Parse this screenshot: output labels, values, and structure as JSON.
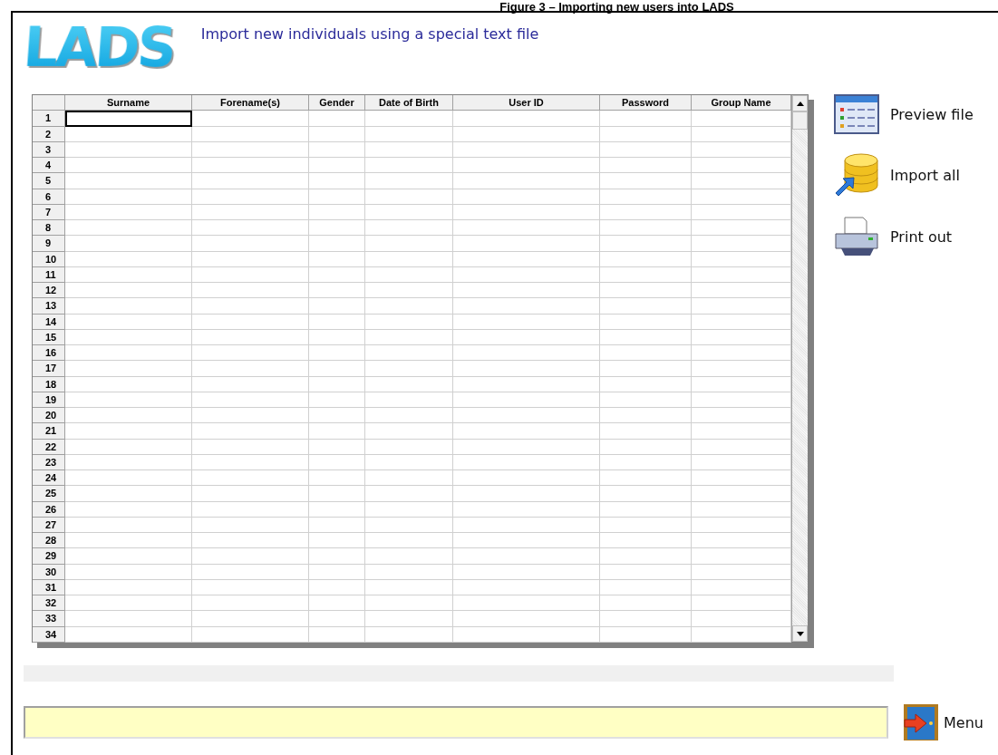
{
  "caption": "Figure 3 – Importing new users into LADS",
  "logo": "LADS",
  "heading": "Import new individuals using a special text file",
  "table": {
    "columns": [
      "Surname",
      "Forename(s)",
      "Gender",
      "Date of Birth",
      "User ID",
      "Password",
      "Group Name"
    ],
    "rows": [
      {
        "label": "1",
        "selected": true
      },
      {
        "label": "2",
        "selected": false
      },
      {
        "label": "3",
        "selected": false
      },
      {
        "label": "4",
        "selected": false
      },
      {
        "label": "5",
        "selected": false
      },
      {
        "label": "6",
        "selected": false
      },
      {
        "label": "7",
        "selected": false
      },
      {
        "label": "8",
        "selected": false
      },
      {
        "label": "9",
        "selected": false
      },
      {
        "label": "10",
        "selected": false
      },
      {
        "label": "11",
        "selected": false
      },
      {
        "label": "12",
        "selected": false
      },
      {
        "label": "13",
        "selected": false
      },
      {
        "label": "14",
        "selected": false
      },
      {
        "label": "15",
        "selected": false
      },
      {
        "label": "16",
        "selected": false
      },
      {
        "label": "17",
        "selected": false
      },
      {
        "label": "18",
        "selected": false
      },
      {
        "label": "19",
        "selected": false
      },
      {
        "label": "20",
        "selected": false
      },
      {
        "label": "21",
        "selected": false
      },
      {
        "label": "22",
        "selected": false
      },
      {
        "label": "23",
        "selected": false
      },
      {
        "label": "24",
        "selected": false
      },
      {
        "label": "25",
        "selected": false
      },
      {
        "label": "26",
        "selected": false
      },
      {
        "label": "27",
        "selected": false
      },
      {
        "label": "28",
        "selected": false
      },
      {
        "label": "29",
        "selected": false
      },
      {
        "label": "30",
        "selected": false
      },
      {
        "label": "31",
        "selected": false
      },
      {
        "label": "32",
        "selected": false
      },
      {
        "label": "33",
        "selected": false
      },
      {
        "label": "34",
        "selected": false
      }
    ]
  },
  "actions": [
    {
      "kind": "preview",
      "label": "Preview file"
    },
    {
      "kind": "import",
      "label": "Import all"
    },
    {
      "kind": "print",
      "label": "Print out"
    }
  ],
  "menu_button": {
    "label": "Menu"
  }
}
